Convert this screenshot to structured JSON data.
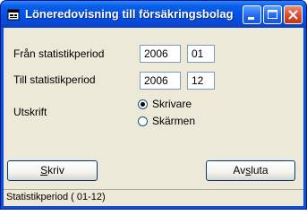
{
  "window": {
    "title": "Löneredovisning till försäkringsbolag",
    "icon": "app-form-icon"
  },
  "form": {
    "from_label": "Från statistikperiod",
    "from_year": "2006",
    "from_month": "01",
    "to_label": "Till statistikperiod",
    "to_year": "2006",
    "to_month": "12",
    "output_label": "Utskrift",
    "output_options": [
      {
        "label": "Skrivare",
        "selected": true
      },
      {
        "label": "Skärmen",
        "selected": false
      }
    ]
  },
  "buttons": {
    "print_rest": "kriv",
    "print_key": "S",
    "exit_pre": "Av",
    "exit_key": "s",
    "exit_post": "luta"
  },
  "status": {
    "text": "Statistikperiod ( 01-12)"
  }
}
